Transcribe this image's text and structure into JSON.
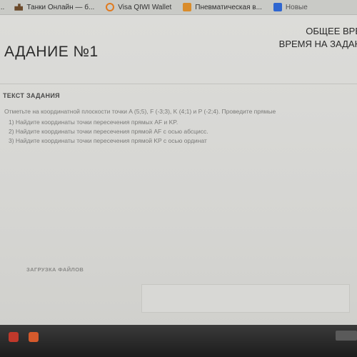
{
  "bookmarks": [
    {
      "label": "...",
      "icon": "page-icon"
    },
    {
      "label": "Танки Онлайн — б...",
      "icon": "tank-icon"
    },
    {
      "label": "Visa QIWI Wallet",
      "icon": "qiwi-icon"
    },
    {
      "label": "Пневматическая в...",
      "icon": "pneumatic-icon"
    },
    {
      "label": "Новые",
      "icon": "bookmark-icon"
    }
  ],
  "task": {
    "title": "АДАНИЕ №1",
    "total_label": "ОБЩЕЕ ВРЕ",
    "time_label": "ВРЕМЯ НА ЗАДАН"
  },
  "section_label": "ТЕКСТ ЗАДАНИЯ",
  "task_text": {
    "intro": "Отметьте на координатной плоскости точки A (5;5), F (-3;3), K (4;1) и P (-2;4). Проведите прямые",
    "items": [
      "1) Найдите координаты точки пересечения прямых AF и KP.",
      "2) Найдите координаты точки пересечения прямой AF с осью абсцисс.",
      "3) Найдите координаты точки пересечения прямой KP с осью ординат"
    ]
  },
  "upload_label": "ЗАГРУЗКА ФАЙЛОВ"
}
